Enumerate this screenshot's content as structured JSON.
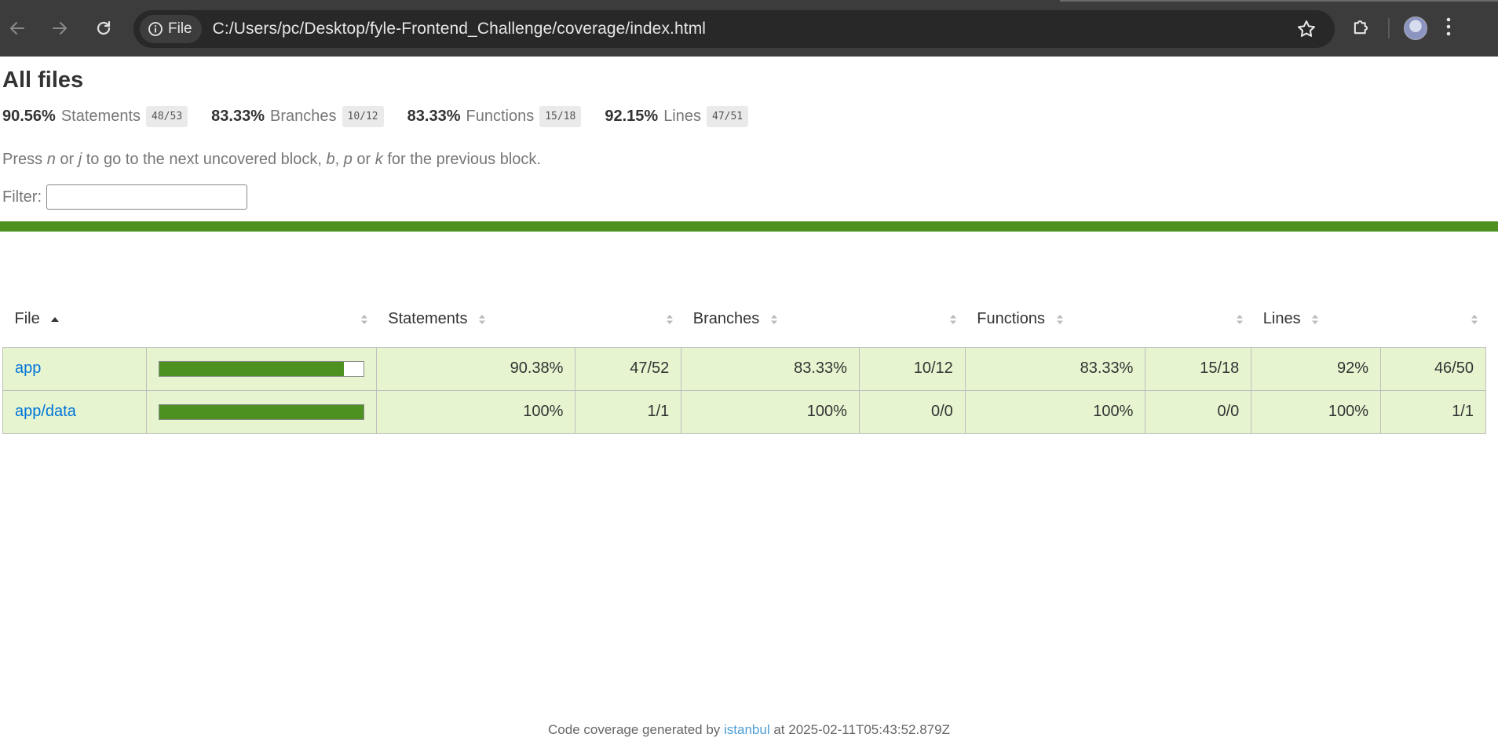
{
  "browser": {
    "scheme_label": "File",
    "url": "C:/Users/pc/Desktop/fyle-Frontend_Challenge/coverage/index.html"
  },
  "report": {
    "title": "All files",
    "summary": [
      {
        "pct": "90.56%",
        "label": "Statements",
        "frac": "48/53"
      },
      {
        "pct": "83.33%",
        "label": "Branches",
        "frac": "10/12"
      },
      {
        "pct": "83.33%",
        "label": "Functions",
        "frac": "15/18"
      },
      {
        "pct": "92.15%",
        "label": "Lines",
        "frac": "47/51"
      }
    ],
    "hint": {
      "p1": "Press ",
      "k1": "n",
      "p2": " or ",
      "k2": "j",
      "p3": " to go to the next uncovered block, ",
      "k3": "b",
      "p4": ", ",
      "k4": "p",
      "p5": " or ",
      "k5": "k",
      "p6": " for the previous block."
    },
    "filter_label": "Filter:",
    "filter_value": "",
    "status_color": "#4d9221"
  },
  "table": {
    "headers": {
      "file": "File",
      "statements": "Statements",
      "branches": "Branches",
      "functions": "Functions",
      "lines": "Lines"
    },
    "rows": [
      {
        "file": "app",
        "coverage_fraction": 0.9038,
        "stmt_pct": "90.38%",
        "stmt_frac": "47/52",
        "br_pct": "83.33%",
        "br_frac": "10/12",
        "fn_pct": "83.33%",
        "fn_frac": "15/18",
        "ln_pct": "92%",
        "ln_frac": "46/50"
      },
      {
        "file": "app/data",
        "coverage_fraction": 1.0,
        "stmt_pct": "100%",
        "stmt_frac": "1/1",
        "br_pct": "100%",
        "br_frac": "0/0",
        "fn_pct": "100%",
        "fn_frac": "0/0",
        "ln_pct": "100%",
        "ln_frac": "1/1"
      }
    ]
  },
  "footer": {
    "prefix": "Code coverage generated by ",
    "link": "istanbul",
    "suffix": " at 2025-02-11T05:43:52.879Z"
  }
}
